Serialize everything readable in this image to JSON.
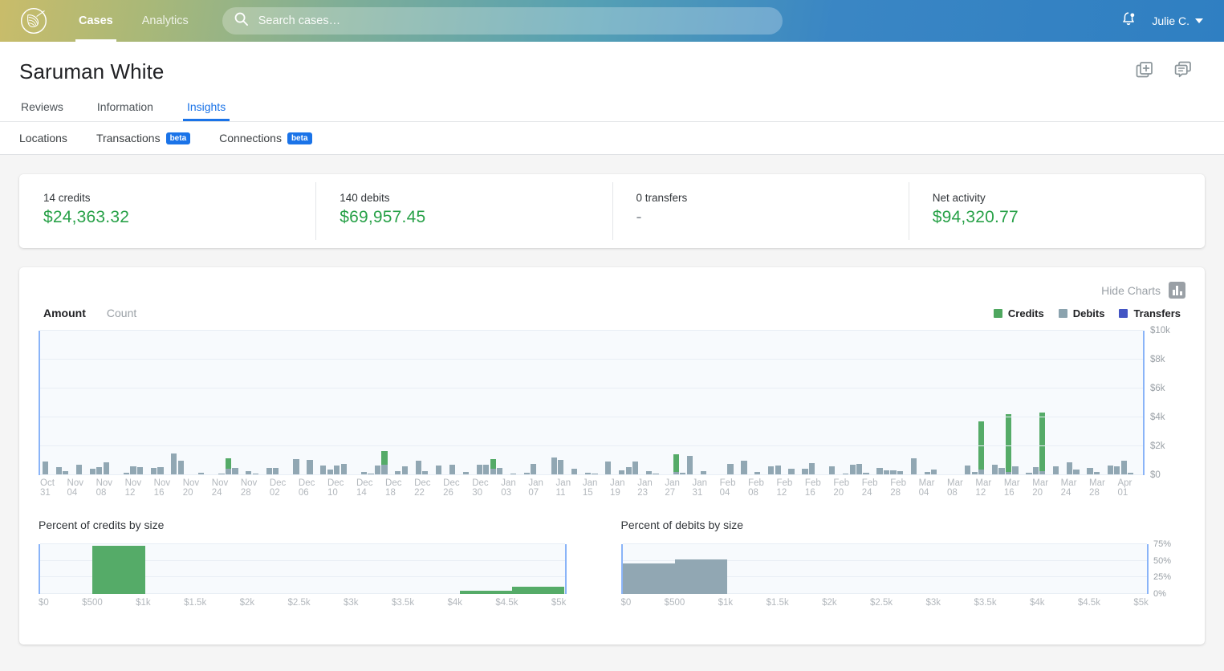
{
  "nav": {
    "logo_icon": "hummingbird-logo",
    "links": [
      {
        "label": "Cases",
        "active": true
      },
      {
        "label": "Analytics",
        "active": false
      }
    ],
    "search": {
      "placeholder": "Search cases…",
      "value": "",
      "icon": "search-icon"
    },
    "notifications_icon": "bell-icon",
    "user": {
      "name": "Julie C.",
      "caret_icon": "chevron-down-icon"
    }
  },
  "header": {
    "title": "Saruman White",
    "actions": [
      {
        "icon": "add-card-icon",
        "name": "add-item-button"
      },
      {
        "icon": "comments-icon",
        "name": "comments-button"
      }
    ],
    "primary_tabs": [
      {
        "label": "Reviews",
        "active": false
      },
      {
        "label": "Information",
        "active": false
      },
      {
        "label": "Insights",
        "active": true
      }
    ],
    "sub_tabs": [
      {
        "label": "Locations",
        "badge": null
      },
      {
        "label": "Transactions",
        "badge": "beta"
      },
      {
        "label": "Connections",
        "badge": "beta"
      }
    ]
  },
  "summary": {
    "cells": [
      {
        "label": "14 credits",
        "value": "$24,363.32",
        "is_dash": false
      },
      {
        "label": "140 debits",
        "value": "$69,957.45",
        "is_dash": false
      },
      {
        "label": "0 transfers",
        "value": "-",
        "is_dash": true
      },
      {
        "label": "Net activity",
        "value": "$94,320.77",
        "is_dash": false
      }
    ]
  },
  "charts_panel": {
    "hide_charts_label": "Hide Charts",
    "hide_charts_icon": "bar-chart-icon",
    "metric_tabs": [
      {
        "label": "Amount",
        "active": true
      },
      {
        "label": "Count",
        "active": false
      }
    ],
    "legend": [
      {
        "label": "Credits",
        "color": "#4ea75f"
      },
      {
        "label": "Debits",
        "color": "#8ba3ae"
      },
      {
        "label": "Transfers",
        "color": "#4355c4"
      }
    ]
  },
  "colors": {
    "credits": "#55ab68",
    "debits": "#91a7b3",
    "transfers": "#4355c4",
    "accent": "#1a73e8",
    "axis_blue": "#8ab4f8",
    "plot_bg": "#f7fafd",
    "money_green": "#28a148"
  },
  "chart_data": [
    {
      "type": "bar",
      "name": "transaction-activity-over-time",
      "title": "",
      "stacked": true,
      "xlabel": "",
      "ylabel": "",
      "ylim": [
        0,
        10000
      ],
      "yticks": [
        "$0",
        "$2k",
        "$4k",
        "$6k",
        "$8k",
        "$10k"
      ],
      "ytick_values": [
        0,
        2000,
        4000,
        6000,
        8000,
        10000
      ],
      "grid": true,
      "legend_position": "top-right",
      "xticks": [
        "Oct 31",
        "Nov 04",
        "Nov 08",
        "Nov 12",
        "Nov 16",
        "Nov 20",
        "Nov 24",
        "Nov 28",
        "Dec 02",
        "Dec 06",
        "Dec 10",
        "Dec 14",
        "Dec 18",
        "Dec 22",
        "Dec 26",
        "Dec 30",
        "Jan 03",
        "Jan 07",
        "Jan 11",
        "Jan 15",
        "Jan 19",
        "Jan 23",
        "Jan 27",
        "Jan 31",
        "Feb 04",
        "Feb 08",
        "Feb 12",
        "Feb 16",
        "Feb 20",
        "Feb 24",
        "Feb 28",
        "Mar 04",
        "Mar 08",
        "Mar 12",
        "Mar 16",
        "Mar 20",
        "Mar 24",
        "Mar 28",
        "Apr 01"
      ],
      "series": [
        {
          "name": "Debits",
          "color": "#91a7b3",
          "values": [
            960,
            0,
            580,
            260,
            0,
            740,
            0,
            420,
            560,
            880,
            0,
            0,
            140,
            620,
            560,
            0,
            480,
            540,
            0,
            1480,
            980,
            0,
            0,
            180,
            60,
            0,
            120,
            420,
            520,
            0,
            280,
            100,
            0,
            480,
            520,
            80,
            0,
            1100,
            0,
            1040,
            0,
            660,
            380,
            640,
            760,
            0,
            0,
            220,
            120,
            640,
            700,
            0,
            300,
            600,
            0,
            980,
            300,
            0,
            640,
            0,
            700,
            0,
            250,
            80,
            700,
            740,
            460,
            500,
            0,
            120,
            0,
            160,
            800,
            0,
            0,
            1220,
            1060,
            0,
            420,
            0,
            140,
            100,
            0,
            920,
            0,
            350,
            540,
            960,
            0,
            260,
            100,
            0,
            0,
            230,
            180,
            1320,
            0,
            290,
            60,
            0,
            0,
            780,
            0,
            1000,
            0,
            220,
            0,
            590,
            640,
            0,
            460,
            0,
            460,
            840,
            0,
            0,
            600,
            0,
            130,
            700,
            760,
            160,
            0,
            520,
            320,
            330,
            260,
            0,
            1150,
            0,
            200,
            380,
            80,
            0,
            0,
            0,
            660,
            220,
            1180,
            0,
            720,
            500,
            0,
            620,
            0,
            160,
            540,
            180,
            0,
            620,
            0,
            880,
            400,
            0,
            480,
            200,
            0,
            680,
            620,
            1020,
            140
          ]
        },
        {
          "name": "Credits",
          "color": "#55ab68",
          "values": [
            0,
            0,
            0,
            0,
            0,
            0,
            0,
            0,
            0,
            0,
            0,
            0,
            0,
            0,
            0,
            0,
            0,
            0,
            0,
            0,
            0,
            0,
            0,
            0,
            0,
            0,
            0,
            760,
            0,
            0,
            0,
            0,
            0,
            0,
            0,
            0,
            0,
            0,
            0,
            0,
            0,
            0,
            0,
            0,
            0,
            0,
            0,
            0,
            0,
            0,
            980,
            0,
            0,
            0,
            0,
            0,
            0,
            0,
            0,
            0,
            0,
            0,
            0,
            0,
            0,
            0,
            640,
            0,
            0,
            0,
            0,
            0,
            0,
            0,
            0,
            0,
            0,
            0,
            0,
            0,
            0,
            0,
            0,
            0,
            0,
            0,
            0,
            0,
            0,
            0,
            0,
            0,
            0,
            1240,
            0,
            0,
            0,
            0,
            0,
            0,
            0,
            0,
            0,
            0,
            0,
            0,
            0,
            0,
            0,
            0,
            0,
            0,
            0,
            0,
            0,
            0,
            0,
            0,
            0,
            0,
            0,
            0,
            0,
            0,
            0,
            0,
            0,
            0,
            0,
            0,
            0,
            0,
            0,
            0,
            0,
            0,
            0,
            0,
            0,
            0,
            0,
            0,
            0,
            0,
            0,
            0,
            0,
            0,
            0,
            0,
            0,
            0,
            0,
            0,
            0,
            0,
            0,
            0,
            0,
            0,
            0,
            0
          ]
        }
      ],
      "spike_bars": [
        {
          "index": 138,
          "debits": 380,
          "credits": 3320
        },
        {
          "index": 142,
          "debits": 200,
          "credits": 4000
        },
        {
          "index": 147,
          "debits": 280,
          "credits": 4060
        }
      ]
    },
    {
      "type": "bar",
      "name": "percent-of-credits-by-size",
      "title": "Percent of credits by size",
      "xlabel": "",
      "ylabel": "",
      "ylim": [
        0,
        75
      ],
      "yticks": [],
      "grid": true,
      "color": "#55ab68",
      "bin_edges": [
        "$0",
        "$500",
        "$1k",
        "$1.5k",
        "$2k",
        "$2.5k",
        "$3k",
        "$3.5k",
        "$4k",
        "$4.5k",
        "$5k"
      ],
      "categories": [
        "$0-$500",
        "$500-$1k",
        "$1k-$1.5k",
        "$1.5k-$2k",
        "$2k-$2.5k",
        "$2.5k-$3k",
        "$3k-$3.5k",
        "$3.5k-$4k",
        "$4k-$4.5k",
        "$4.5k-$5k"
      ],
      "values": [
        0,
        72,
        0,
        0,
        0,
        0,
        0,
        0,
        5,
        11
      ]
    },
    {
      "type": "bar",
      "name": "percent-of-debits-by-size",
      "title": "Percent of debits by size",
      "xlabel": "",
      "ylabel": "",
      "ylim": [
        0,
        75
      ],
      "yticks": [
        "0%",
        "25%",
        "50%",
        "75%"
      ],
      "ytick_values": [
        0,
        25,
        50,
        75
      ],
      "grid": true,
      "color": "#91a7b3",
      "bin_edges": [
        "$0",
        "$500",
        "$1k",
        "$1.5k",
        "$2k",
        "$2.5k",
        "$3k",
        "$3.5k",
        "$4k",
        "$4.5k",
        "$5k"
      ],
      "categories": [
        "$0-$500",
        "$500-$1k",
        "$1k-$1.5k",
        "$1.5k-$2k",
        "$2k-$2.5k",
        "$2.5k-$3k",
        "$3k-$3.5k",
        "$3.5k-$4k",
        "$4k-$4.5k",
        "$4.5k-$5k"
      ],
      "values": [
        46,
        52,
        0,
        0,
        0,
        0,
        0,
        0,
        0,
        0
      ]
    }
  ]
}
